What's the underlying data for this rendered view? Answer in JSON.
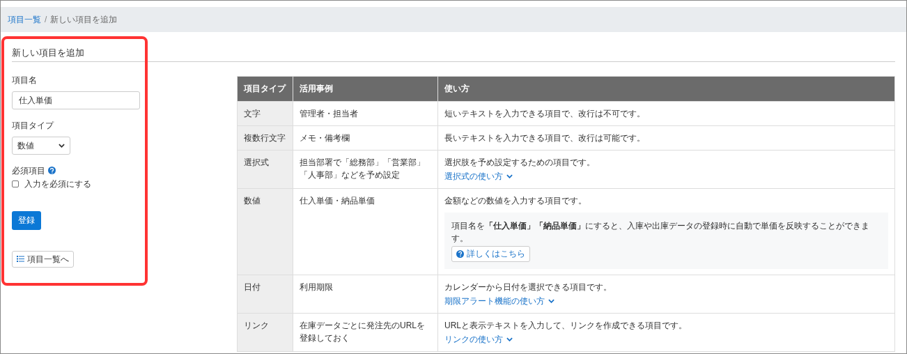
{
  "breadcrumb_separator": "/",
  "breadcrumb": [
    {
      "label": "項目一覧",
      "kind": "link"
    },
    {
      "label": "新しい項目を追加",
      "kind": "current"
    }
  ],
  "form": {
    "title": "新しい項目を追加",
    "name_label": "項目名",
    "name_value": "仕入単価",
    "type_label": "項目タイプ",
    "type_value": "数値",
    "required_label": "必須項目",
    "required_checkbox": {
      "label": "入力を必須にする",
      "checked": false
    },
    "submit": "登録",
    "back": "項目一覧へ",
    "highlighted": true
  },
  "table": {
    "columns": [
      "項目タイプ",
      "活用事例",
      "使い方"
    ],
    "rows": [
      {
        "type": "文字",
        "example": "管理者・担当者",
        "usage": "短いテキストを入力できる項目で、改行は不可です。"
      },
      {
        "type": "複数行文字",
        "example": "メモ・備考欄",
        "usage": "長いテキストを入力できる項目で、改行は可能です。"
      },
      {
        "type": "選択式",
        "example": "担当部署で「総務部」「営業部」「人事部」などを予め設定",
        "usage": "選択肢を予め設定するための項目です。",
        "link": "選択式の使い方"
      },
      {
        "type": "数値",
        "example": "仕入単価・納品単価",
        "usage": "金額などの数値を入力する項目です。",
        "note": {
          "text": "項目名を**「仕入単価」「納品単価」**にすると、入庫や出庫データの登録時に自動で単価を反映することができます。",
          "button": "詳しくはこちら"
        }
      },
      {
        "type": "日付",
        "example": "利用期限",
        "usage": "カレンダーから日付を選択できる項目です。",
        "link": "期限アラート機能の使い方"
      },
      {
        "type": "リンク",
        "example": "在庫データごとに発注先のURLを登録しておく",
        "usage": "URLと表示テキストを入力して、リンクを作成できる項目です。",
        "link": "リンクの使い方"
      }
    ]
  }
}
